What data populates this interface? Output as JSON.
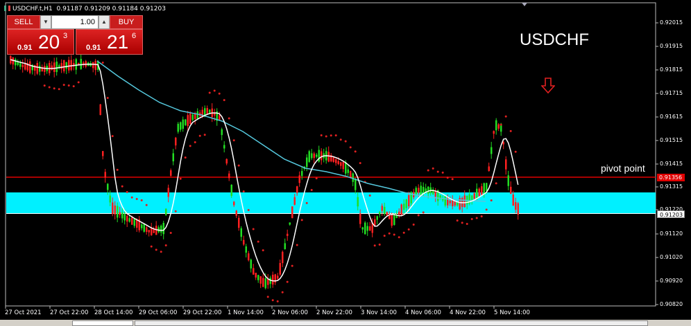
{
  "header": {
    "symbol_timeframe": "USDCHF.t,H1",
    "ohlc": "0.91187 0.91209 0.91184 0.91203"
  },
  "trade_panel": {
    "sell_label": "SELL",
    "buy_label": "BUY",
    "lot_value": "1.00",
    "sell_prefix": "0.91",
    "sell_big": "20",
    "sell_pip": "3",
    "buy_prefix": "0.91",
    "buy_big": "21",
    "buy_pip": "6"
  },
  "annotations": {
    "symbol_title": "USDCHF",
    "pivot_label": "pivot point"
  },
  "price_axis": [
    "0.92015",
    "0.91915",
    "0.91815",
    "0.91715",
    "0.91615",
    "0.91515",
    "0.91415",
    "0.91315",
    "0.91220",
    "0.91120",
    "0.91020",
    "0.90920",
    "0.90820"
  ],
  "price_tags": {
    "pivot": "0.91356",
    "current": "0.91203"
  },
  "time_axis": [
    "27 Oct 2021",
    "27 Oct 22:00",
    "28 Oct 14:00",
    "29 Oct 06:00",
    "29 Oct 22:00",
    "1 Nov 14:00",
    "2 Nov 06:00",
    "2 Nov 22:00",
    "3 Nov 14:00",
    "4 Nov 06:00",
    "4 Nov 22:00",
    "5 Nov 14:00"
  ],
  "colors": {
    "bull": "#22dd22",
    "bear": "#ff2020",
    "moving_average_fast": "#ffffff",
    "moving_average_slow": "#55c8dd",
    "parabolic_sar": "#e02020",
    "zone": "#00f0ff",
    "pivot_line": "#e00000"
  }
}
